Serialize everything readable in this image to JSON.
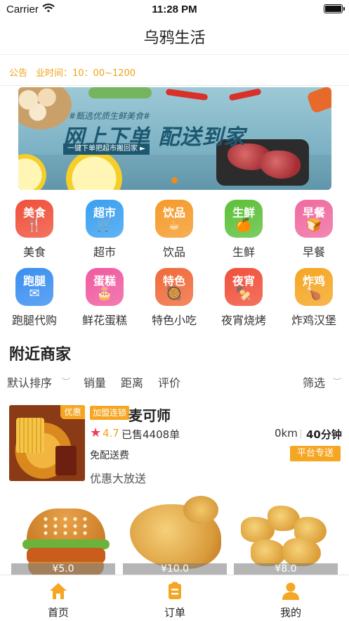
{
  "status_bar": {
    "carrier": "Carrier",
    "time": "11:28 PM"
  },
  "nav": {
    "title": "乌鸦生活"
  },
  "notice": {
    "label": "公告",
    "text": "业时间：10：00~1200"
  },
  "banner": {
    "tagline": "#甄选优质生鲜美食#",
    "headline": "网上下单 配送到家",
    "subline": "一键下单把超市搬回家 ►"
  },
  "categories": [
    {
      "icon_text": "美食",
      "label": "美食",
      "color": "#f0503a",
      "glyph": "🍴"
    },
    {
      "icon_text": "超市",
      "label": "超市",
      "color": "#3aa0f0",
      "glyph": "🛒"
    },
    {
      "icon_text": "饮品",
      "label": "饮品",
      "color": "#f59a2a",
      "glyph": "☕"
    },
    {
      "icon_text": "生鲜",
      "label": "生鲜",
      "color": "#5cc03a",
      "glyph": "🍊"
    },
    {
      "icon_text": "早餐",
      "label": "早餐",
      "color": "#f06aa0",
      "glyph": "🍞"
    },
    {
      "icon_text": "跑腿",
      "label": "跑腿代购",
      "color": "#3a8ef0",
      "glyph": "✉"
    },
    {
      "icon_text": "蛋糕",
      "label": "鲜花蛋糕",
      "color": "#f05aa0",
      "glyph": "🎂"
    },
    {
      "icon_text": "特色",
      "label": "特色小吃",
      "color": "#f06a3a",
      "glyph": "🥘"
    },
    {
      "icon_text": "夜宵",
      "label": "夜宵烧烤",
      "color": "#f0503a",
      "glyph": "🍢"
    },
    {
      "icon_text": "炸鸡",
      "label": "炸鸡汉堡",
      "color": "#f5a623",
      "glyph": "🍗"
    }
  ],
  "nearby": {
    "title": "附近商家",
    "sort": {
      "default": "默认排序",
      "sales": "销量",
      "distance": "距离",
      "rating": "评价",
      "filter": "筛选"
    }
  },
  "merchant": {
    "sale_badge": "优惠",
    "tag": "加盟连锁",
    "name": "麦可师",
    "rating": "4.7",
    "sold": "已售4408单",
    "distance": "0km",
    "eta": "40分钟",
    "delivery_fee": "免配送费",
    "delivery_mode": "平台专送",
    "promo": "优惠大放送"
  },
  "products": [
    {
      "price": "¥5.0"
    },
    {
      "price": "¥10.0"
    },
    {
      "price": "¥8.0"
    }
  ],
  "tabs": [
    {
      "label": "首页",
      "active": true
    },
    {
      "label": "订单",
      "active": false
    },
    {
      "label": "我的",
      "active": false
    }
  ],
  "colors": {
    "accent": "#f5a623",
    "notice": "#f0a21a",
    "star": "#f23a5a"
  }
}
